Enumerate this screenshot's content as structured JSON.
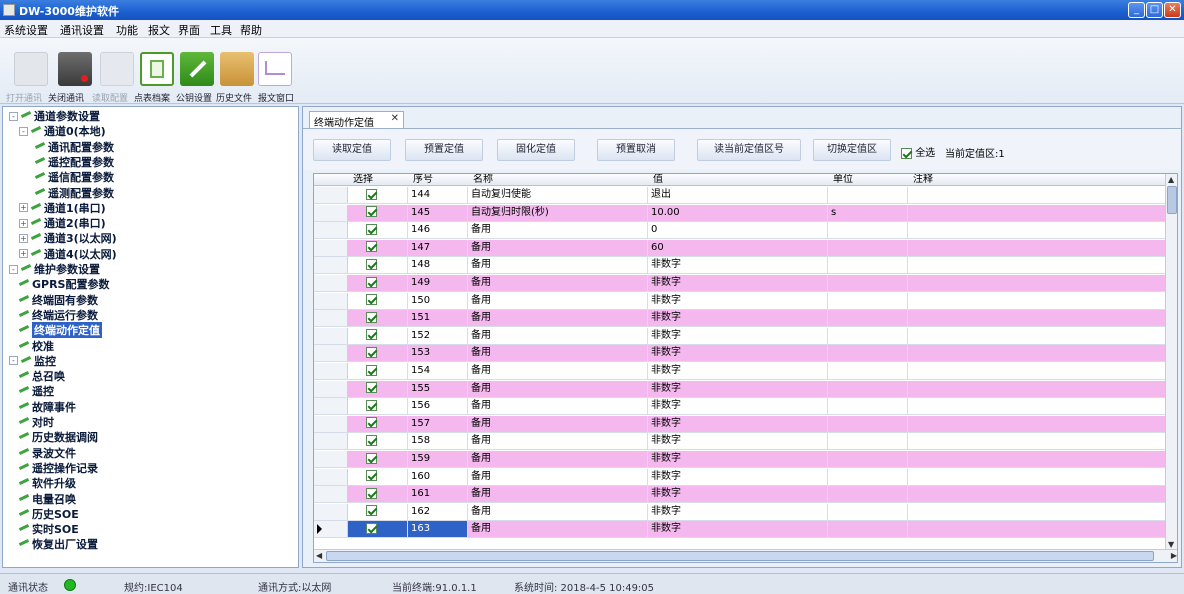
{
  "window": {
    "title": "DW-3000维护软件"
  },
  "menu": [
    "系统设置",
    "通讯设置",
    "功能",
    "报文",
    "界面",
    "工具",
    "帮助"
  ],
  "toolbar": [
    {
      "label": "打开通讯",
      "icon": "open-comm-icon",
      "enabled": false
    },
    {
      "label": "关闭通讯",
      "icon": "close-comm-icon",
      "enabled": true
    },
    {
      "label": "读取配置",
      "icon": "read-config-icon",
      "enabled": false
    },
    {
      "label": "点表档案",
      "icon": "point-table-icon",
      "enabled": true
    },
    {
      "label": "公钥设置",
      "icon": "key-settings-icon",
      "enabled": true
    },
    {
      "label": "历史文件",
      "icon": "folder-icon",
      "enabled": true
    },
    {
      "label": "报文窗口",
      "icon": "message-window-icon",
      "enabled": true
    }
  ],
  "tree": [
    {
      "label": "通道参数设置",
      "level": 0,
      "expander": "-"
    },
    {
      "label": "通道0(本地)",
      "level": 1,
      "expander": "-"
    },
    {
      "label": "通讯配置参数",
      "level": 2
    },
    {
      "label": "遥控配置参数",
      "level": 2
    },
    {
      "label": "遥信配置参数",
      "level": 2
    },
    {
      "label": "遥测配置参数",
      "level": 2
    },
    {
      "label": "通道1(串口)",
      "level": 1,
      "expander": "+"
    },
    {
      "label": "通道2(串口)",
      "level": 1,
      "expander": "+"
    },
    {
      "label": "通道3(以太网)",
      "level": 1,
      "expander": "+"
    },
    {
      "label": "通道4(以太网)",
      "level": 1,
      "expander": "+"
    },
    {
      "label": "维护参数设置",
      "level": 0,
      "expander": "-"
    },
    {
      "label": "GPRS配置参数",
      "level": 1
    },
    {
      "label": "终端固有参数",
      "level": 1
    },
    {
      "label": "终端运行参数",
      "level": 1
    },
    {
      "label": "终端动作定值",
      "level": 1,
      "selected": true
    },
    {
      "label": "校准",
      "level": 1
    },
    {
      "label": "监控",
      "level": 0,
      "expander": "-"
    },
    {
      "label": "总召唤",
      "level": 1
    },
    {
      "label": "遥控",
      "level": 1
    },
    {
      "label": "故障事件",
      "level": 1
    },
    {
      "label": "对时",
      "level": 1
    },
    {
      "label": "历史数据调阅",
      "level": 1
    },
    {
      "label": "录波文件",
      "level": 1
    },
    {
      "label": "遥控操作记录",
      "level": 1
    },
    {
      "label": "软件升级",
      "level": 1
    },
    {
      "label": "电量召唤",
      "level": 1
    },
    {
      "label": "历史SOE",
      "level": 1
    },
    {
      "label": "实时SOE",
      "level": 1
    },
    {
      "label": "恢复出厂设置",
      "level": 1
    }
  ],
  "tab": {
    "label": "终端动作定值",
    "close": "✕"
  },
  "actions": [
    "读取定值",
    "预置定值",
    "固化定值",
    "预置取消",
    "读当前定值区号",
    "切换定值区"
  ],
  "select_all": {
    "label": "全选",
    "checked": true
  },
  "current_zone": "当前定值区:1",
  "columns": [
    "选择",
    "序号",
    "名称",
    "值",
    "单位",
    "注释"
  ],
  "rows": [
    {
      "checked": true,
      "seq": "144",
      "name": "自动复归使能",
      "value": "退出",
      "unit": "",
      "color": "white"
    },
    {
      "checked": true,
      "seq": "145",
      "name": "自动复归时限(秒)",
      "value": "10.00",
      "unit": "s",
      "color": "pink"
    },
    {
      "checked": true,
      "seq": "146",
      "name": "备用",
      "value": "0",
      "unit": "",
      "color": "white"
    },
    {
      "checked": true,
      "seq": "147",
      "name": "备用",
      "value": "60",
      "unit": "",
      "color": "pink"
    },
    {
      "checked": true,
      "seq": "148",
      "name": "备用",
      "value": "非数字",
      "unit": "",
      "color": "white"
    },
    {
      "checked": true,
      "seq": "149",
      "name": "备用",
      "value": "非数字",
      "unit": "",
      "color": "pink"
    },
    {
      "checked": true,
      "seq": "150",
      "name": "备用",
      "value": "非数字",
      "unit": "",
      "color": "white"
    },
    {
      "checked": true,
      "seq": "151",
      "name": "备用",
      "value": "非数字",
      "unit": "",
      "color": "pink"
    },
    {
      "checked": true,
      "seq": "152",
      "name": "备用",
      "value": "非数字",
      "unit": "",
      "color": "white"
    },
    {
      "checked": true,
      "seq": "153",
      "name": "备用",
      "value": "非数字",
      "unit": "",
      "color": "pink"
    },
    {
      "checked": true,
      "seq": "154",
      "name": "备用",
      "value": "非数字",
      "unit": "",
      "color": "white"
    },
    {
      "checked": true,
      "seq": "155",
      "name": "备用",
      "value": "非数字",
      "unit": "",
      "color": "pink"
    },
    {
      "checked": true,
      "seq": "156",
      "name": "备用",
      "value": "非数字",
      "unit": "",
      "color": "white"
    },
    {
      "checked": true,
      "seq": "157",
      "name": "备用",
      "value": "非数字",
      "unit": "",
      "color": "pink"
    },
    {
      "checked": true,
      "seq": "158",
      "name": "备用",
      "value": "非数字",
      "unit": "",
      "color": "white"
    },
    {
      "checked": true,
      "seq": "159",
      "name": "备用",
      "value": "非数字",
      "unit": "",
      "color": "pink"
    },
    {
      "checked": true,
      "seq": "160",
      "name": "备用",
      "value": "非数字",
      "unit": "",
      "color": "white"
    },
    {
      "checked": true,
      "seq": "161",
      "name": "备用",
      "value": "非数字",
      "unit": "",
      "color": "pink"
    },
    {
      "checked": true,
      "seq": "162",
      "name": "备用",
      "value": "非数字",
      "unit": "",
      "color": "white"
    },
    {
      "checked": true,
      "seq": "163",
      "name": "备用",
      "value": "非数字",
      "unit": "",
      "color": "pink",
      "selected": true
    }
  ],
  "status": {
    "comm_label": "通讯状态",
    "comm_state_color": "#23b823",
    "protocol": "规约:IEC104",
    "comm_mode": "通讯方式:以太网",
    "current_terminal": "当前终端:91.0.1.1",
    "system_time": "系统时间: 2018-4-5 10:49:05"
  },
  "colors": {
    "row_pink": "#f4b8ee",
    "selection": "#2f62c6",
    "title_bar": "#1c5fd0"
  }
}
